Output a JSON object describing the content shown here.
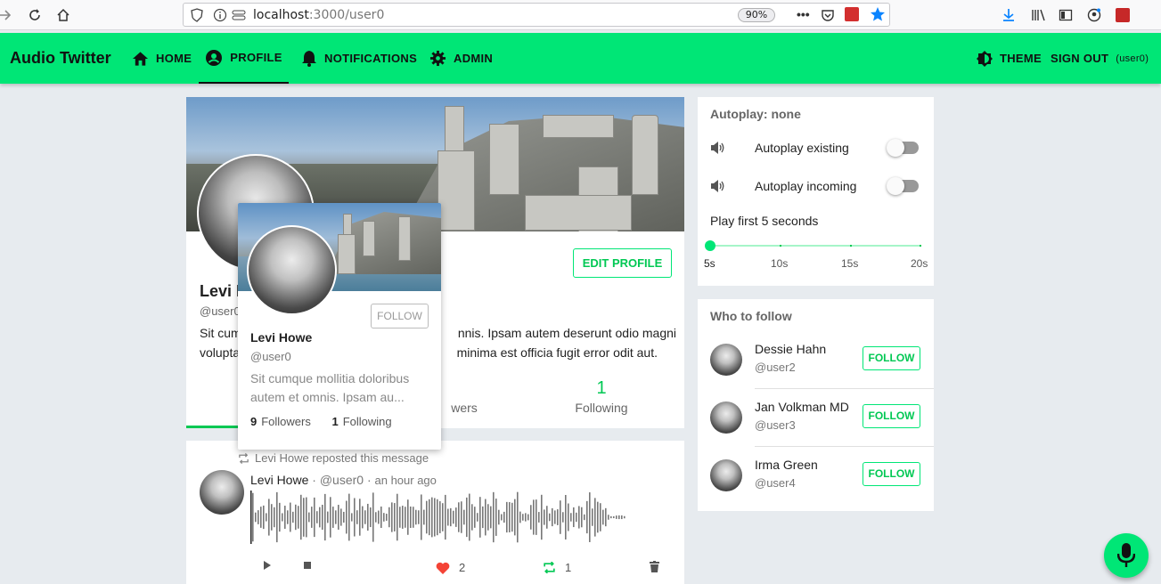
{
  "browser": {
    "url_host": "localhost",
    "url_path": ":3000/user0",
    "zoom": "90%"
  },
  "header": {
    "brand": "Audio Twitter",
    "nav": [
      {
        "label": "HOME",
        "icon": "home-icon"
      },
      {
        "label": "PROFILE",
        "icon": "account-circle-icon"
      },
      {
        "label": "NOTIFICATIONS",
        "icon": "bell-icon"
      },
      {
        "label": "ADMIN",
        "icon": "gear-icon"
      }
    ],
    "theme_label": "THEME",
    "signout_label": "SIGN OUT",
    "user_tag": "(user0)"
  },
  "profile": {
    "name_visible": "Levi H",
    "handle_visible": "@user0",
    "edit_label": "EDIT PROFILE",
    "bio_line1": "Sit cum",
    "bio_line1_end": "nnis. Ipsam autem deserunt odio magni",
    "bio_line2": "volupta",
    "bio_line2_end": "minima est officia fugit error odit aut.",
    "stats": {
      "followers_label_visible": "wers",
      "following_count": "1",
      "following_label": "Following"
    }
  },
  "hover_card": {
    "follow_label": "FOLLOW",
    "name": "Levi Howe",
    "handle": "@user0",
    "bio": "Sit cumque mollitia doloribus autem et omnis. Ipsam au...",
    "followers_count": "9",
    "followers_label": "Followers",
    "following_count": "1",
    "following_label": "Following"
  },
  "post": {
    "repost_text": "Levi Howe reposted this message",
    "author": "Levi Howe",
    "handle": "· @user0 ·",
    "time": "an hour ago",
    "likes": "2",
    "reposts": "1"
  },
  "autoplay": {
    "title": "Autoplay: none",
    "existing_label": "Autoplay existing",
    "incoming_label": "Autoplay incoming",
    "existing_on": false,
    "incoming_on": false,
    "play_first_label": "Play first 5 seconds",
    "slider_value": 5,
    "slider_marks": [
      "5s",
      "10s",
      "15s",
      "20s"
    ]
  },
  "who_to_follow": {
    "title": "Who to follow",
    "users": [
      {
        "name": "Dessie Hahn",
        "handle": "@user2",
        "button": "FOLLOW"
      },
      {
        "name": "Jan Volkman MD",
        "handle": "@user3",
        "button": "FOLLOW"
      },
      {
        "name": "Irma Green",
        "handle": "@user4",
        "button": "FOLLOW"
      }
    ]
  },
  "colors": {
    "accent": "#00e676",
    "accent_dark": "#00c853",
    "like": "#f44336"
  }
}
